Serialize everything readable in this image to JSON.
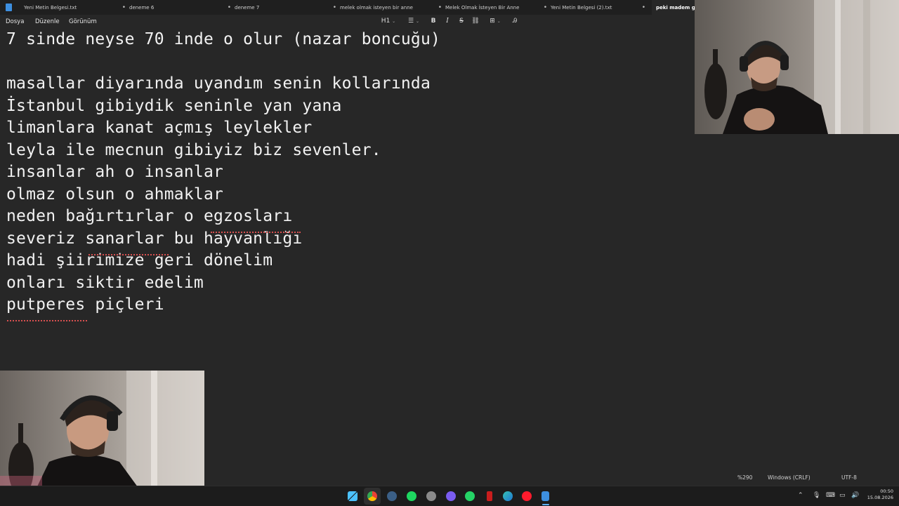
{
  "tabs": [
    {
      "label": "Yeni Metin Belgesi.txt",
      "modified": "•"
    },
    {
      "label": "deneme 6",
      "modified": "•"
    },
    {
      "label": "deneme 7",
      "modified": "•"
    },
    {
      "label": "melek olmak isteyen bir anne",
      "modified": "•"
    },
    {
      "label": "Melek Olmak İsteyen Bir Anne",
      "modified": "•"
    },
    {
      "label": "Yeni Metin Belgesi (2).txt",
      "modified": "•"
    },
    {
      "label": "peki madem geld",
      "modified": ""
    }
  ],
  "menu": {
    "file": "Dosya",
    "edit": "Düzenle",
    "view": "Görünüm"
  },
  "toolbar": {
    "heading": "H1",
    "bold": "B",
    "italic": "I",
    "strike": "S",
    "list_icon": "list-icon",
    "link_icon": "link-icon",
    "table_icon": "table-icon",
    "clear_icon": "clear-format-icon"
  },
  "document": {
    "title_line": "7 sinde neyse 70 inde o olur (nazar boncuğu)",
    "lines": [
      "masallar diyarında uyandım senin kollarında",
      "İstanbul gibiydik seninle yan yana",
      "limanlara kanat açmış leylekler",
      "leyla ile mecnun gibiyiz biz sevenler.",
      "insanlar ah o insanlar",
      "olmaz olsun o ahmaklar",
      "neden bağırtırlar o egzosları",
      "severiz sanarlar bu hayvanlığı",
      "hadi şiirimize geri dönelim",
      "onları siktir edelim",
      "putperes piçleri"
    ]
  },
  "status": {
    "zoom": "%290",
    "line_ending": "Windows (CRLF)",
    "encoding": "UTF-8"
  },
  "clock": {
    "time": "00:50",
    "date": "15.08.2026"
  },
  "colors": {
    "tab_bg": "#1f1f1f",
    "editor_bg": "#272727",
    "text": "#f2f2f2",
    "spell_error": "#e25b5b"
  }
}
